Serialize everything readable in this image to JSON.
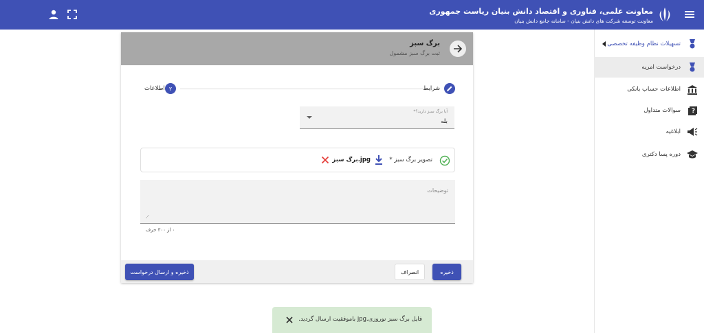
{
  "header": {
    "title": "معاونت علمی، فناوری و اقتصاد دانش بنیان ریاست جمهوری",
    "subtitle": "معاونت توسعه شرکت های دانش بنیان - سامانه جامع دانش بنیان",
    "brand_color": "#3f51b5"
  },
  "sidebar": {
    "items": [
      {
        "label": "تسهیلات نظام وظیفه تخصصی",
        "icon": "medal-icon"
      },
      {
        "label": "درخواست امریه",
        "icon": "medal-icon"
      },
      {
        "label": "اطلاعات حساب بانکی",
        "icon": "bank-icon"
      },
      {
        "label": "سوالات متداول",
        "icon": "question-icon"
      },
      {
        "label": "ابلاغیه",
        "icon": "megaphone-icon"
      },
      {
        "label": "دوره پسا دکتری",
        "icon": "graduation-cap-icon"
      }
    ]
  },
  "page": {
    "title": "برگ سبز",
    "subtitle": "ثبت برگ سبز مشمول"
  },
  "stepper": {
    "step1_label": "شرایط",
    "step2_label": "اطلاعات",
    "step2_number": "۲"
  },
  "form": {
    "select_label": "آیا برگ سبز دارید؟*",
    "select_value": "بله",
    "upload_label": "تصویر برگ سبز *",
    "upload_filename": "برگ سبز.jpg",
    "description_label": "توضیحات",
    "counter": "۰ از ۳۰۰ حرف"
  },
  "buttons": {
    "save": "ذخیره",
    "cancel": "انصراف",
    "save_submit": "ذخیره و ارسال درخواست"
  },
  "toast": {
    "message": "فایل برگ سبز نوروزی.jpg باموفقیت ارسال گردید."
  }
}
